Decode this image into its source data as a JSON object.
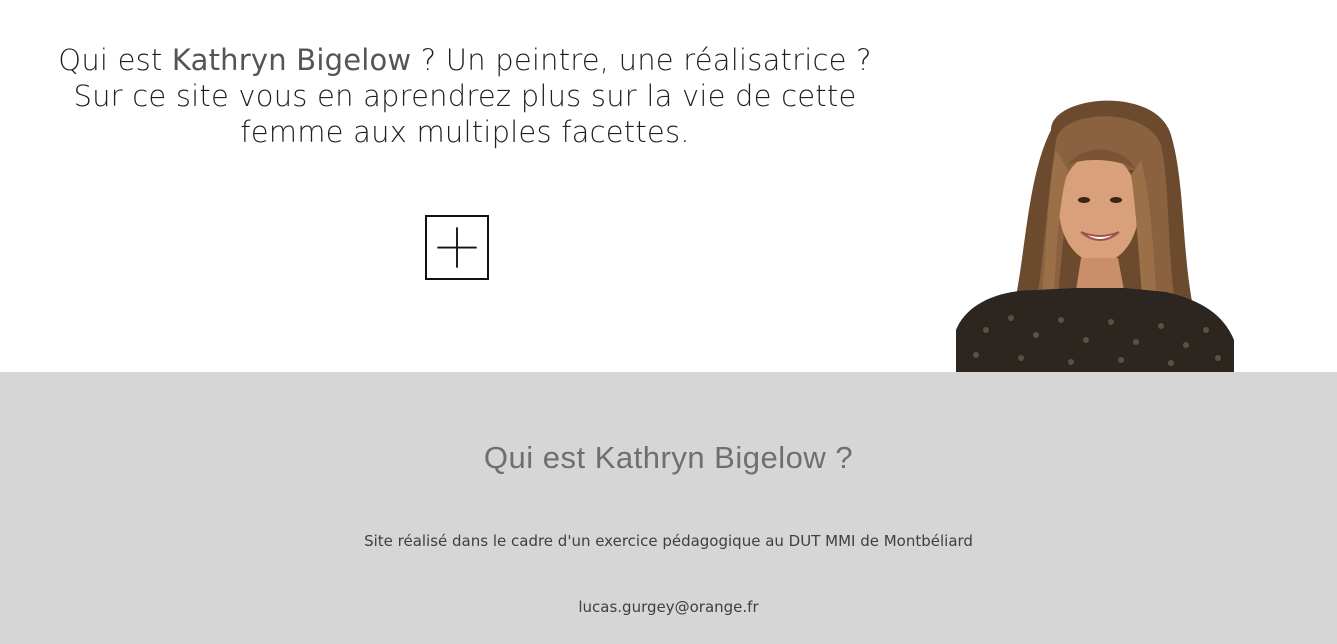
{
  "hero": {
    "intro_prefix": "Qui est ",
    "intro_name": "Kathryn Bigelow",
    "intro_suffix": " ? Un peintre, une réalisatrice ?",
    "intro_line2": "Sur ce site vous en aprendrez plus sur la vie de cette",
    "intro_line3": "femme aux multiples facettes.",
    "more_button_icon": "plus-icon",
    "portrait_subject": "Kathryn Bigelow"
  },
  "footer": {
    "title": "Qui est Kathryn Bigelow ?",
    "credit": "Site réalisé dans le cadre d'un exercice pédagogique au DUT MMI de Montbéliard",
    "email": "lucas.gurgey@orange.fr"
  },
  "colors": {
    "footer_background": "#d6d6d6",
    "footer_title": "#6f6f6f",
    "text": "#1f1f1f"
  }
}
